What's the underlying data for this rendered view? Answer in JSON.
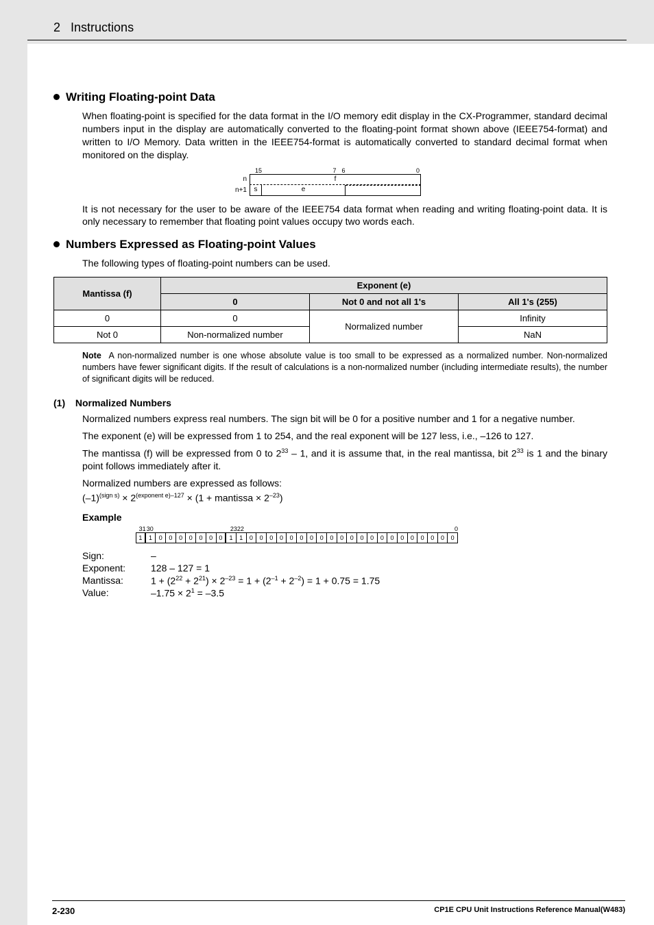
{
  "header": {
    "chapter_num": "2",
    "chapter_title": "Instructions"
  },
  "sec1": {
    "heading": "Writing Floating-point Data",
    "para1": "When floating-point is specified for the data format in the I/O memory edit display in the CX-Programmer, standard decimal numbers input in the display are automatically converted to the floating-point format shown above (IEEE754-format) and written to I/O Memory. Data written in the IEEE754-format is automatically converted to standard decimal format when monitored on the display.",
    "para2": "It is not necessary for the user to be aware of the IEEE754 data format when reading and writing floating-point data. It is only necessary to remember that floating point values occupy two words each."
  },
  "word_diag": {
    "bit15": "15",
    "bit7": "7",
    "bit6": "6",
    "bit0": "0",
    "row_n": "n",
    "row_n1": "n+1",
    "f": "f",
    "s": "s",
    "e": "e"
  },
  "sec2": {
    "heading": "Numbers Expressed as Floating-point Values",
    "intro": "The following types of floating-point numbers can be used."
  },
  "table": {
    "h_mantissa": "Mantissa (f)",
    "h_exponent": "Exponent (e)",
    "h_c0": "0",
    "h_cnz": "Not 0 and not all 1's",
    "h_call1": "All 1's (255)",
    "r1_m": "0",
    "r1_c0": "0",
    "r12_cnz": "Normalized number",
    "r1_call1": "Infinity",
    "r2_m": "Not 0",
    "r2_c0": "Non-normalized number",
    "r2_call1": "NaN"
  },
  "note": {
    "label": "Note",
    "text": "A non-normalized number is one whose absolute value is too small to be expressed as a normalized number. Non-normalized numbers have fewer significant digits. If the result of calculations is a non-normalized number (including intermediate results), the number of significant digits will be reduced."
  },
  "sub1": {
    "num": "(1)",
    "title": "Normalized Numbers",
    "p1": "Normalized numbers express real numbers. The sign bit will be 0 for a positive number and 1 for a negative number.",
    "p2": "The exponent (e) will be expressed from 1 to 254, and the real exponent will be 127 less, i.e., –126 to 127.",
    "p3a": "The mantissa (f) will be expressed from 0 to 2",
    "p3b": " – 1, and it is assume that, in the real mantissa, bit 2",
    "p3c": " is 1 and the binary point follows immediately after it.",
    "p4": "Normalized numbers are expressed as follows:",
    "formula_a": "(–1)",
    "formula_b": " × 2",
    "formula_c": " × (1 + mantissa × 2",
    "formula_d": ")",
    "sup_sign": "(sign s)",
    "sup_exp": "(exponent e)–127",
    "sup_m23": "–23",
    "sup33": "33",
    "example_label": "Example"
  },
  "bits": {
    "l31": "31",
    "l30": "30",
    "l23": "23",
    "l22": "22",
    "l0": "0",
    "cells": [
      "1",
      "1",
      "0",
      "0",
      "0",
      "0",
      "0",
      "0",
      "0",
      "1",
      "1",
      "0",
      "0",
      "0",
      "0",
      "0",
      "0",
      "0",
      "0",
      "0",
      "0",
      "0",
      "0",
      "0",
      "0",
      "0",
      "0",
      "0",
      "0",
      "0",
      "0",
      "0"
    ]
  },
  "calc": {
    "sign_l": "Sign:",
    "sign_v": "–",
    "exp_l": "Exponent:",
    "exp_v": "128 – 127 = 1",
    "man_l": "Mantissa:",
    "man_a": "1 + (2",
    "man_b": " + 2",
    "man_c": ") × 2",
    "man_d": " = 1 + (2",
    "man_e": " + 2",
    "man_f": ") = 1 + 0.75 = 1.75",
    "s22": "22",
    "s21": "21",
    "sn23": "–23",
    "sn1": "–1",
    "sn2": "–2",
    "val_l": "Value:",
    "val_a": "–1.75 × 2",
    "val_b": " = –3.5",
    "s1": "1"
  },
  "footer": {
    "page": "2-230",
    "ref": "CP1E CPU Unit Instructions Reference Manual(W483)"
  }
}
